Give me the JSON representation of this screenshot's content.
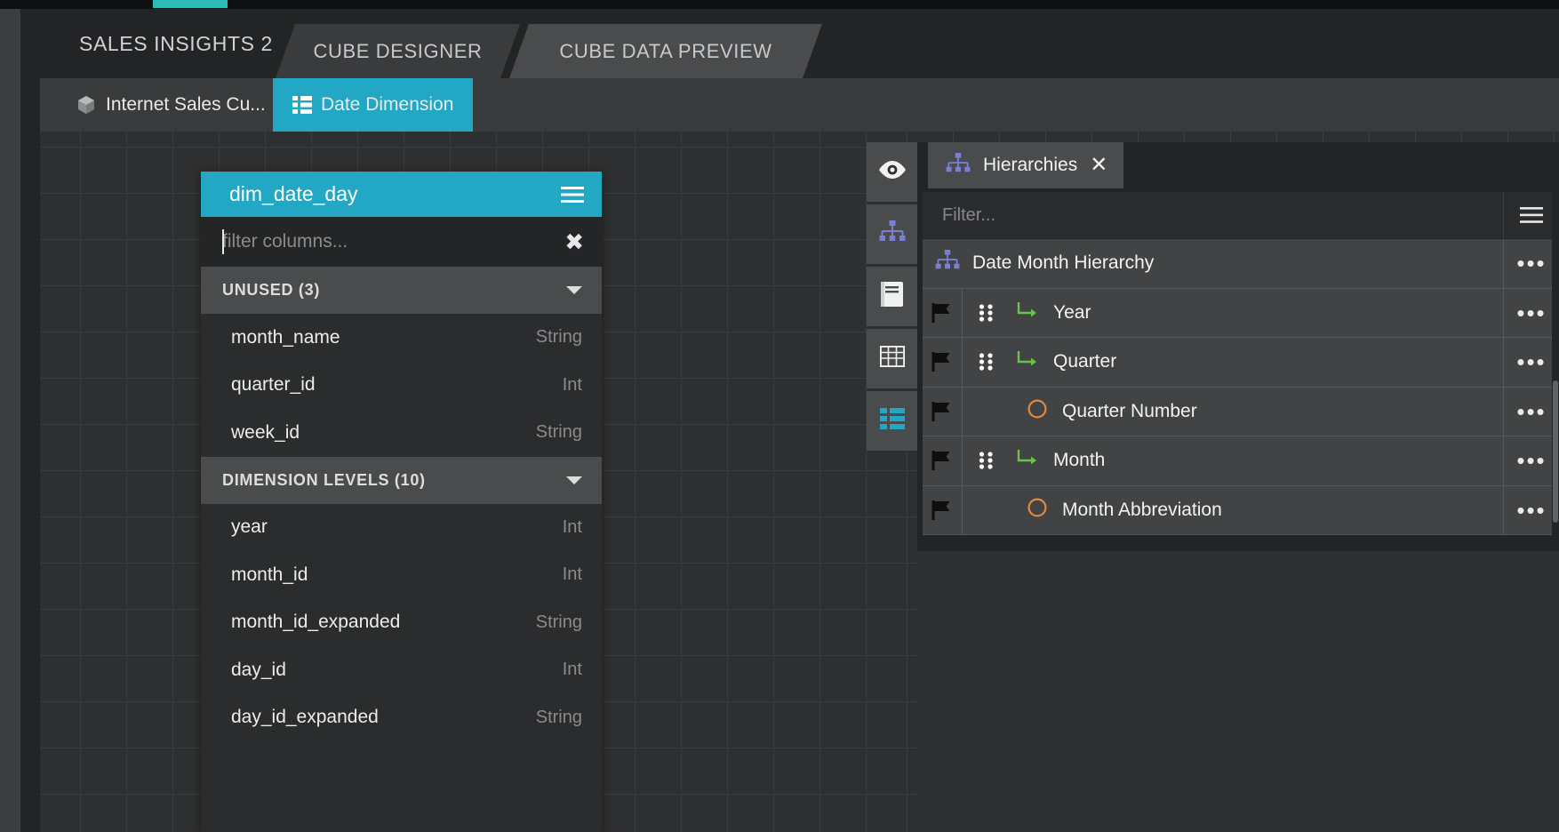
{
  "window": {
    "project_tab": "SALES INSIGHTS 2",
    "tabs": [
      {
        "label": "CUBE DESIGNER",
        "active": true
      },
      {
        "label": "CUBE DATA PREVIEW",
        "active": false
      }
    ],
    "subtabs": [
      {
        "label": "Internet Sales Cu...",
        "icon": "cube-icon",
        "active": false
      },
      {
        "label": "Date Dimension",
        "icon": "grid-icon",
        "active": true
      }
    ]
  },
  "table_card": {
    "title": "dim_date_day",
    "menu_icon": "hamburger-icon",
    "filter": {
      "placeholder": "filter columns...",
      "value": "",
      "clear_icon": "close-icon"
    },
    "groups": [
      {
        "label": "UNUSED (3)",
        "collapse_icon": "chevron-down-icon",
        "columns": [
          {
            "name": "month_name",
            "type": "String"
          },
          {
            "name": "quarter_id",
            "type": "Int"
          },
          {
            "name": "week_id",
            "type": "String"
          }
        ]
      },
      {
        "label": "DIMENSION LEVELS (10)",
        "collapse_icon": "chevron-down-icon",
        "columns": [
          {
            "name": "year",
            "type": "Int"
          },
          {
            "name": "month_id",
            "type": "Int"
          },
          {
            "name": "month_id_expanded",
            "type": "String"
          },
          {
            "name": "day_id",
            "type": "Int"
          },
          {
            "name": "day_id_expanded",
            "type": "String"
          }
        ]
      }
    ]
  },
  "icon_rail": [
    {
      "icon": "eye-icon",
      "name": "visibility"
    },
    {
      "icon": "hierarchy-icon",
      "name": "hierarchies"
    },
    {
      "icon": "book-icon",
      "name": "dictionary"
    },
    {
      "icon": "table-icon",
      "name": "table"
    },
    {
      "icon": "list-icon",
      "name": "columns",
      "accent": "#22a7c4"
    }
  ],
  "hierarchies_panel": {
    "tab_label": "Hierarchies",
    "tab_icon": "hierarchy-icon",
    "close_icon": "close-icon",
    "filter": {
      "placeholder": "Filter...",
      "value": ""
    },
    "filter_menu_icon": "hamburger-icon",
    "rows": [
      {
        "label": "Date Month Hierarchy",
        "kind": "root",
        "icon": "hierarchy-icon",
        "flag": false,
        "drag": false,
        "more": "more-icon"
      },
      {
        "label": "Year",
        "kind": "level",
        "icon": "arrow-branch-icon",
        "flag": true,
        "drag": true,
        "more": "more-icon"
      },
      {
        "label": "Quarter",
        "kind": "level",
        "icon": "arrow-branch-icon",
        "flag": true,
        "drag": true,
        "more": "more-icon"
      },
      {
        "label": "Quarter Number",
        "kind": "attribute",
        "icon": "circle-icon",
        "flag": true,
        "drag": false,
        "more": "more-icon"
      },
      {
        "label": "Month",
        "kind": "level",
        "icon": "arrow-branch-icon",
        "flag": true,
        "drag": true,
        "more": "more-icon"
      },
      {
        "label": "Month Abbreviation",
        "kind": "attribute",
        "icon": "circle-icon",
        "flag": true,
        "drag": false,
        "more": "more-icon"
      }
    ]
  },
  "colors": {
    "accent_teal": "#22a7c4",
    "accent_green": "#6ac24a",
    "accent_orange": "#e2893f",
    "accent_purple": "#7b7fd4",
    "tab_nub": "#2dbdb6"
  }
}
